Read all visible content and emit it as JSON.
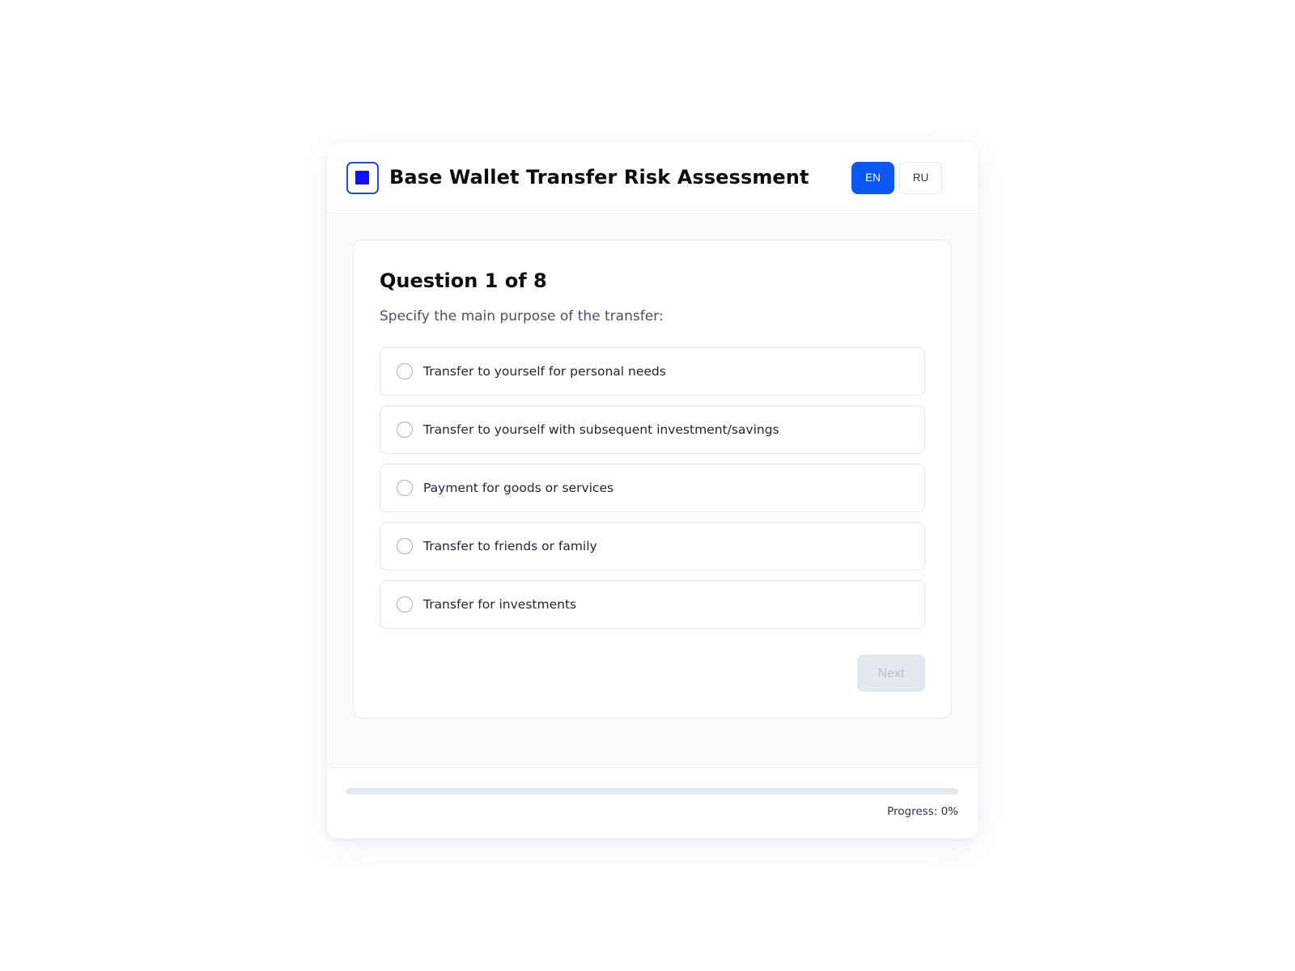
{
  "header": {
    "title": "Base Wallet Transfer Risk Assessment",
    "logo_icon": "square-logo-icon",
    "languages": [
      {
        "code": "EN",
        "active": true
      },
      {
        "code": "RU",
        "active": false
      }
    ]
  },
  "question": {
    "title": "Question 1 of 8",
    "text": "Specify the main purpose of the transfer:",
    "options": [
      {
        "label": "Transfer to yourself for personal needs",
        "selected": false
      },
      {
        "label": "Transfer to yourself with subsequent investment/savings",
        "selected": false
      },
      {
        "label": "Payment for goods or services",
        "selected": false
      },
      {
        "label": "Transfer to friends or family",
        "selected": false
      },
      {
        "label": "Transfer for investments",
        "selected": false
      }
    ],
    "next_label": "Next",
    "next_enabled": false
  },
  "footer": {
    "progress_text": "Progress: 0%",
    "progress_value": 0
  },
  "colors": {
    "accent": "#0b57f5",
    "logo_fill": "#1010ff",
    "disabled_bg": "#e4e8ee",
    "disabled_text": "#b7bfcb"
  }
}
